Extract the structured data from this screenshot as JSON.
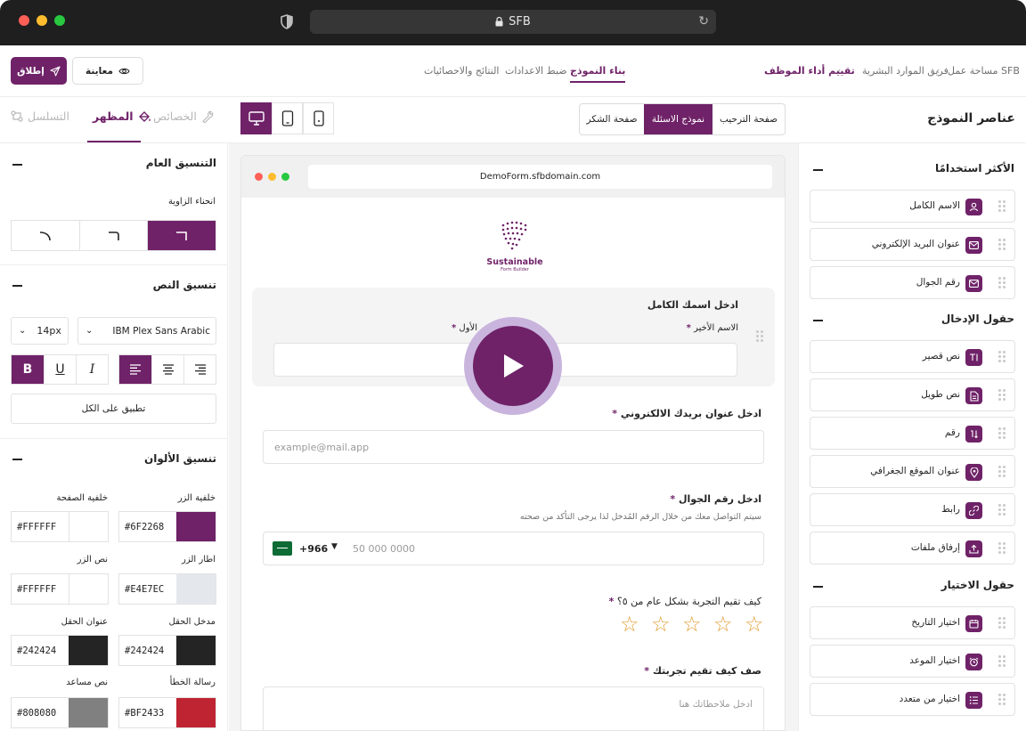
{
  "browser": {
    "url": "SFB"
  },
  "header": {
    "launch_label": "إطلاق",
    "preview_label": "معاينة",
    "tabs": [
      {
        "label": "بناء النموذج",
        "active": true
      },
      {
        "label": "ضبط الاعدادات",
        "active": false
      },
      {
        "label": "النتائج والاحصائيات",
        "active": false
      }
    ],
    "breadcrumb": [
      "مساحة عمل SFB",
      "فريق الموارد البشرية",
      "تقييم أداء الموظف"
    ]
  },
  "toolbar": {
    "panel_tabs": [
      {
        "label": "التسلسل",
        "active": false
      },
      {
        "label": "المظهر",
        "active": true
      },
      {
        "label": "الخصائص",
        "active": false
      }
    ],
    "devices": [
      "desktop-icon",
      "tablet-icon",
      "mobile-icon"
    ],
    "pages": [
      {
        "label": "صفحة الشكر",
        "active": false
      },
      {
        "label": "نموذج الاسئلة",
        "active": true
      },
      {
        "label": "صفحة الترحيب",
        "active": false
      }
    ],
    "elements_title": "عناصر النموذج"
  },
  "appearance": {
    "general": {
      "title": "التنسيق العام",
      "corner_label": "انحناء الزاوية"
    },
    "text": {
      "title": "تنسيق النص",
      "size": "14px",
      "font": "IBM Plex Sans Arabic",
      "bold": "B",
      "underline": "U",
      "italic": "I",
      "apply_all": "تطبيق على الكل"
    },
    "colors": {
      "title": "تنسيق الألوان",
      "fields": [
        {
          "label": "خلفية الزر",
          "hex": "#6F2268"
        },
        {
          "label": "خلفية الصفحة",
          "hex": "#FFFFFF"
        },
        {
          "label": "اطار الزر",
          "hex": "#E4E7EC"
        },
        {
          "label": "نص الزر",
          "hex": "#FFFFFF"
        },
        {
          "label": "مدخل الحقل",
          "hex": "#242424"
        },
        {
          "label": "عنوان الحقل",
          "hex": "#242424"
        },
        {
          "label": "رسالة الخطأ",
          "hex": "#BF2433"
        },
        {
          "label": "نص مساعد",
          "hex": "#808080"
        }
      ]
    }
  },
  "form": {
    "url": "DemoForm.sfbdomain.com",
    "logo_title": "Sustainable",
    "logo_subtitle": "Form Builder",
    "q1": {
      "title": "ادخل اسمك الكامل",
      "last_label": "الاسم الأخير",
      "first_label": "الأول"
    },
    "q2": {
      "title": "ادخل عنوان بريدك الالكتروني",
      "placeholder": "example@mail.app"
    },
    "q3": {
      "title": "ادخل رقم الجوال",
      "helper": "سيتم التواصل معك من خلال الرقم المُدخل لذا يرجى التأكد من صحته",
      "code": "+966",
      "placeholder": "50 000 0000"
    },
    "q4": {
      "title": "كيف تقيم التجربة بشكل عام من ٥؟",
      "stars": 5,
      "rating": 0
    },
    "q5": {
      "title": "صف كيف تقيم تجربتك",
      "placeholder": "ادخل ملاحظاتك هنا"
    },
    "required_mark": "*"
  },
  "elements": {
    "groups": [
      {
        "title": "الأكثر استخدامًا",
        "items": [
          {
            "label": "الاسم الكامل",
            "icon": "person-icon"
          },
          {
            "label": "عنوان البريد الإلكتروني",
            "icon": "mail-icon"
          },
          {
            "label": "رقم الجوال",
            "icon": "mail-icon"
          }
        ]
      },
      {
        "title": "حقول الإدخال",
        "items": [
          {
            "label": "نص قصير",
            "icon": "short-text-icon"
          },
          {
            "label": "نص طويل",
            "icon": "document-icon"
          },
          {
            "label": "رقم",
            "icon": "number-icon"
          },
          {
            "label": "عنوان الموقع الجغرافي",
            "icon": "location-icon"
          },
          {
            "label": "رابط",
            "icon": "link-icon"
          },
          {
            "label": "إرفاق ملفات",
            "icon": "upload-icon"
          }
        ]
      },
      {
        "title": "حقول الاختيار",
        "items": [
          {
            "label": "اختيار التاريخ",
            "icon": "calendar-icon"
          },
          {
            "label": "اختيار الموعد",
            "icon": "alarm-icon"
          },
          {
            "label": "اختيار من متعدد",
            "icon": "list-icon"
          }
        ]
      }
    ]
  },
  "colors": {
    "accent": "#6f2268",
    "star": "#e0a03a",
    "play": "#c9b4dd"
  }
}
